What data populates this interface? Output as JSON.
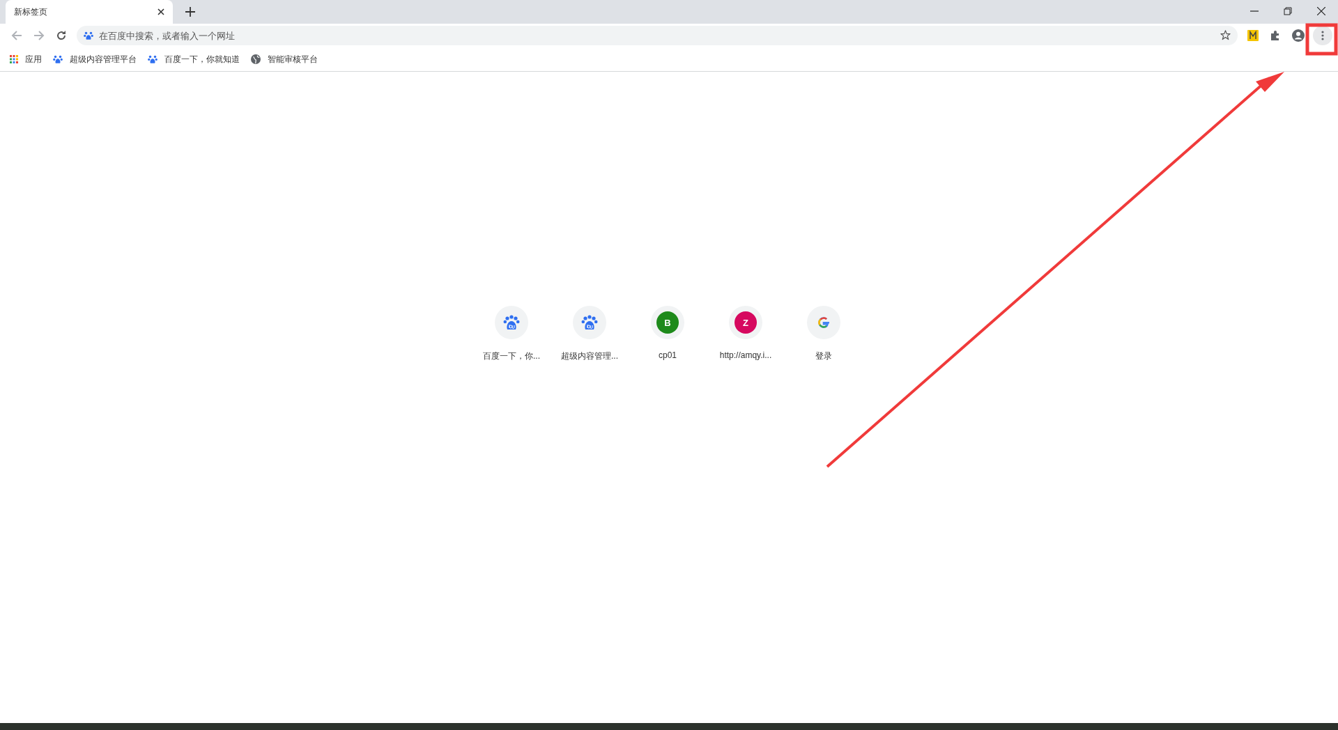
{
  "tab": {
    "title": "新标签页",
    "selected": true
  },
  "omnibox": {
    "placeholder": "在百度中搜索，或者输入一个网址"
  },
  "bookmarks": [
    {
      "kind": "apps",
      "label": "应用"
    },
    {
      "kind": "baidu",
      "label": "超级内容管理平台"
    },
    {
      "kind": "baidu",
      "label": "百度一下，你就知道"
    },
    {
      "kind": "globe",
      "label": "智能审核平台"
    }
  ],
  "shortcuts": [
    {
      "kind": "baidu",
      "title": "百度一下，你..."
    },
    {
      "kind": "baidu",
      "title": "超级内容管理..."
    },
    {
      "kind": "letter",
      "letter": "B",
      "color": "#1e8a1b",
      "title": "cp01"
    },
    {
      "kind": "letter",
      "letter": "Z",
      "color": "#d6095f",
      "title": "http://amqy.i..."
    },
    {
      "kind": "google",
      "title": "登录"
    }
  ]
}
